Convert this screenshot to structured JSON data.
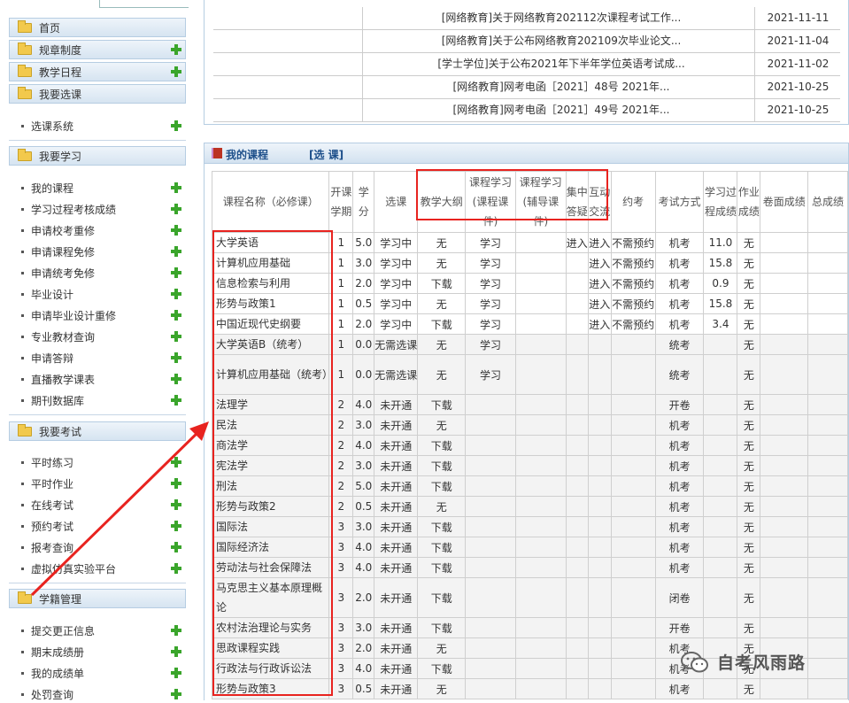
{
  "sidebar": {
    "top_menus": [
      {
        "label": "首页"
      },
      {
        "label": "规章制度"
      },
      {
        "label": "教学日程"
      },
      {
        "label": "我要选课"
      }
    ],
    "select_course_items": [
      {
        "label": "选课系统"
      }
    ],
    "study_header": "我要学习",
    "study_items": [
      {
        "label": "我的课程"
      },
      {
        "label": "学习过程考核成绩"
      },
      {
        "label": "申请校考重修"
      },
      {
        "label": "申请课程免修"
      },
      {
        "label": "申请统考免修"
      },
      {
        "label": "毕业设计"
      },
      {
        "label": "申请毕业设计重修"
      },
      {
        "label": "专业教材查询"
      },
      {
        "label": "申请答辩"
      },
      {
        "label": "直播教学课表"
      },
      {
        "label": "期刊数据库"
      }
    ],
    "exam_header": "我要考试",
    "exam_items": [
      {
        "label": "平时练习"
      },
      {
        "label": "平时作业"
      },
      {
        "label": "在线考试"
      },
      {
        "label": "预约考试"
      },
      {
        "label": "报考查询"
      },
      {
        "label": "虚拟仿真实验平台"
      }
    ],
    "status_header": "学籍管理",
    "status_items": [
      {
        "label": "提交更正信息"
      },
      {
        "label": "期末成绩册"
      },
      {
        "label": "我的成绩单"
      },
      {
        "label": "处罚查询"
      }
    ]
  },
  "notices": [
    {
      "title": "[网络教育]关于网络教育202112次课程考试工作...",
      "date": "2021-11-11"
    },
    {
      "title": "[网络教育]关于公布网络教育202109次毕业论文...",
      "date": "2021-11-04"
    },
    {
      "title": "[学士学位]关于公布2021年下半年学位英语考试成...",
      "date": "2021-11-02"
    },
    {
      "title": "[网络教育]网考电函［2021］48号 2021年...",
      "date": "2021-10-25"
    },
    {
      "title": "[网络教育]网考电函［2021］49号 2021年...",
      "date": "2021-10-25"
    }
  ],
  "course_panel": {
    "title": "我的课程",
    "select_link": "[选 课]"
  },
  "columns": [
    "课程名称（必修课）",
    "开课学期",
    "学分",
    "选课",
    "教学大纲",
    "课程学习(课程课件)",
    "课程学习(辅导课件)",
    "集中答疑",
    "互动交流",
    "约考",
    "考试方式",
    "学习过程成绩",
    "作业成绩",
    "卷面成绩",
    "总成绩"
  ],
  "courses": [
    {
      "name": "大学英语",
      "term": "1",
      "credit": "5.0",
      "status": "学习中",
      "outline": "无",
      "study1": "学习",
      "study2": "",
      "qa": "进入",
      "chat": "进入",
      "book": "不需预约",
      "mode": "机考",
      "process": "11.0",
      "hw": "无",
      "paper": "",
      "total": ""
    },
    {
      "name": "计算机应用基础",
      "term": "1",
      "credit": "3.0",
      "status": "学习中",
      "outline": "无",
      "study1": "学习",
      "study2": "",
      "qa": "",
      "chat": "进入",
      "book": "不需预约",
      "mode": "机考",
      "process": "15.8",
      "hw": "无",
      "paper": "",
      "total": ""
    },
    {
      "name": "信息检索与利用",
      "term": "1",
      "credit": "2.0",
      "status": "学习中",
      "outline": "下载",
      "study1": "学习",
      "study2": "",
      "qa": "",
      "chat": "进入",
      "book": "不需预约",
      "mode": "机考",
      "process": "0.9",
      "hw": "无",
      "paper": "",
      "total": ""
    },
    {
      "name": "形势与政策1",
      "term": "1",
      "credit": "0.5",
      "status": "学习中",
      "outline": "无",
      "study1": "学习",
      "study2": "",
      "qa": "",
      "chat": "进入",
      "book": "不需预约",
      "mode": "机考",
      "process": "15.8",
      "hw": "无",
      "paper": "",
      "total": ""
    },
    {
      "name": "中国近现代史纲要",
      "term": "1",
      "credit": "2.0",
      "status": "学习中",
      "outline": "下载",
      "study1": "学习",
      "study2": "",
      "qa": "",
      "chat": "进入",
      "book": "不需预约",
      "mode": "机考",
      "process": "3.4",
      "hw": "无",
      "paper": "",
      "total": ""
    },
    {
      "name": "大学英语B（统考）",
      "term": "1",
      "credit": "0.0",
      "status": "无需选课",
      "outline": "无",
      "study1": "学习",
      "study2": "",
      "qa": "",
      "chat": "",
      "book": "",
      "mode": "统考",
      "process": "",
      "hw": "无",
      "paper": "",
      "total": ""
    },
    {
      "name": "计算机应用基础（统考）",
      "term": "1",
      "credit": "0.0",
      "status": "无需选课",
      "outline": "无",
      "study1": "学习",
      "study2": "",
      "qa": "",
      "chat": "",
      "book": "",
      "mode": "统考",
      "process": "",
      "hw": "无",
      "paper": "",
      "total": "",
      "tall": true
    },
    {
      "name": "法理学",
      "term": "2",
      "credit": "4.0",
      "status": "未开通",
      "outline": "下载",
      "study1": "",
      "study2": "",
      "qa": "",
      "chat": "",
      "book": "",
      "mode": "开卷",
      "process": "",
      "hw": "无",
      "paper": "",
      "total": ""
    },
    {
      "name": "民法",
      "term": "2",
      "credit": "3.0",
      "status": "未开通",
      "outline": "无",
      "study1": "",
      "study2": "",
      "qa": "",
      "chat": "",
      "book": "",
      "mode": "机考",
      "process": "",
      "hw": "无",
      "paper": "",
      "total": ""
    },
    {
      "name": "商法学",
      "term": "2",
      "credit": "4.0",
      "status": "未开通",
      "outline": "下载",
      "study1": "",
      "study2": "",
      "qa": "",
      "chat": "",
      "book": "",
      "mode": "机考",
      "process": "",
      "hw": "无",
      "paper": "",
      "total": ""
    },
    {
      "name": "宪法学",
      "term": "2",
      "credit": "3.0",
      "status": "未开通",
      "outline": "下载",
      "study1": "",
      "study2": "",
      "qa": "",
      "chat": "",
      "book": "",
      "mode": "机考",
      "process": "",
      "hw": "无",
      "paper": "",
      "total": ""
    },
    {
      "name": "刑法",
      "term": "2",
      "credit": "5.0",
      "status": "未开通",
      "outline": "下载",
      "study1": "",
      "study2": "",
      "qa": "",
      "chat": "",
      "book": "",
      "mode": "机考",
      "process": "",
      "hw": "无",
      "paper": "",
      "total": ""
    },
    {
      "name": "形势与政策2",
      "term": "2",
      "credit": "0.5",
      "status": "未开通",
      "outline": "无",
      "study1": "",
      "study2": "",
      "qa": "",
      "chat": "",
      "book": "",
      "mode": "机考",
      "process": "",
      "hw": "无",
      "paper": "",
      "total": ""
    },
    {
      "name": "国际法",
      "term": "3",
      "credit": "3.0",
      "status": "未开通",
      "outline": "下载",
      "study1": "",
      "study2": "",
      "qa": "",
      "chat": "",
      "book": "",
      "mode": "机考",
      "process": "",
      "hw": "无",
      "paper": "",
      "total": ""
    },
    {
      "name": "国际经济法",
      "term": "3",
      "credit": "4.0",
      "status": "未开通",
      "outline": "下载",
      "study1": "",
      "study2": "",
      "qa": "",
      "chat": "",
      "book": "",
      "mode": "机考",
      "process": "",
      "hw": "无",
      "paper": "",
      "total": ""
    },
    {
      "name": "劳动法与社会保障法",
      "term": "3",
      "credit": "4.0",
      "status": "未开通",
      "outline": "下载",
      "study1": "",
      "study2": "",
      "qa": "",
      "chat": "",
      "book": "",
      "mode": "机考",
      "process": "",
      "hw": "无",
      "paper": "",
      "total": ""
    },
    {
      "name": "马克思主义基本原理概论",
      "term": "3",
      "credit": "2.0",
      "status": "未开通",
      "outline": "下载",
      "study1": "",
      "study2": "",
      "qa": "",
      "chat": "",
      "book": "",
      "mode": "闭卷",
      "process": "",
      "hw": "无",
      "paper": "",
      "total": "",
      "tall": true
    },
    {
      "name": "农村法治理论与实务",
      "term": "3",
      "credit": "3.0",
      "status": "未开通",
      "outline": "下载",
      "study1": "",
      "study2": "",
      "qa": "",
      "chat": "",
      "book": "",
      "mode": "开卷",
      "process": "",
      "hw": "无",
      "paper": "",
      "total": ""
    },
    {
      "name": "思政课程实践",
      "term": "3",
      "credit": "2.0",
      "status": "未开通",
      "outline": "无",
      "study1": "",
      "study2": "",
      "qa": "",
      "chat": "",
      "book": "",
      "mode": "机考",
      "process": "",
      "hw": "无",
      "paper": "",
      "total": ""
    },
    {
      "name": "行政法与行政诉讼法",
      "term": "3",
      "credit": "4.0",
      "status": "未开通",
      "outline": "下载",
      "study1": "",
      "study2": "",
      "qa": "",
      "chat": "",
      "book": "",
      "mode": "机考",
      "process": "",
      "hw": "无",
      "paper": "",
      "total": ""
    },
    {
      "name": "形势与政策3",
      "term": "3",
      "credit": "0.5",
      "status": "未开通",
      "outline": "无",
      "study1": "",
      "study2": "",
      "qa": "",
      "chat": "",
      "book": "",
      "mode": "机考",
      "process": "",
      "hw": "无",
      "paper": "",
      "total": ""
    }
  ],
  "watermark": "自考风雨路",
  "colors": {
    "annotation": "#e8231f",
    "plus": "#3aa52b",
    "link": "#1d4f8a",
    "folder": "#f2c94c"
  }
}
